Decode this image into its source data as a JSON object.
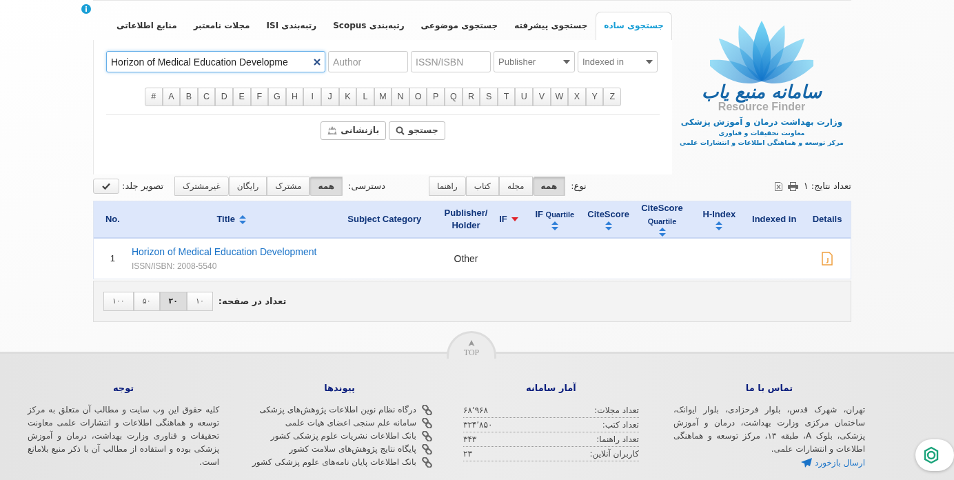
{
  "logo": {
    "title": "سامانه منبع یاب",
    "subtitle": "Resource Finder",
    "org_lines": [
      "وزارت بهداشت درمان و آموزش پزشکی",
      "معاونت تحقیقات و فناوری",
      "مرکز توسعه و هماهنگی اطلاعات و انتشارات علمی"
    ]
  },
  "tabs": [
    {
      "label": "جستجوی ساده",
      "selected": true
    },
    {
      "label": "جستجوی پیشرفته",
      "selected": false
    },
    {
      "label": "جستجوی موضوعی",
      "selected": false
    },
    {
      "label": "رتبه‌بندی Scopus",
      "selected": false
    },
    {
      "label": "رتبه‌بندی ISI",
      "selected": false
    },
    {
      "label": "مجلات نامعتبر",
      "selected": false
    },
    {
      "label": "منابع اطلاعاتی",
      "selected": false
    }
  ],
  "search": {
    "fields": [
      {
        "kind": "select",
        "placeholder": "Indexed in",
        "focused": false
      },
      {
        "kind": "select",
        "placeholder": "Publisher",
        "focused": false
      },
      {
        "kind": "text",
        "placeholder": "ISSN/ISBN",
        "focused": false
      },
      {
        "kind": "text",
        "placeholder": "Author",
        "focused": false
      },
      {
        "kind": "text",
        "value": "Horizon of Medical Education Developme",
        "focused": true
      }
    ],
    "letters": [
      "Z",
      "Y",
      "X",
      "W",
      "V",
      "U",
      "T",
      "S",
      "R",
      "Q",
      "P",
      "O",
      "N",
      "M",
      "L",
      "K",
      "J",
      "I",
      "H",
      "G",
      "F",
      "E",
      "D",
      "C",
      "B",
      "A",
      "#"
    ],
    "search_button": "جستجو",
    "reset_button": "بازنشانی"
  },
  "filters": {
    "result_count": "تعداد نتایج: ۱",
    "type": {
      "label": "نوع:",
      "options": [
        {
          "label": "همه",
          "selected": true
        },
        {
          "label": "مجله",
          "selected": false
        },
        {
          "label": "کتاب",
          "selected": false
        },
        {
          "label": "راهنما",
          "selected": false
        }
      ]
    },
    "access": {
      "label": "دسترسی:",
      "options": [
        {
          "label": "همه",
          "selected": true
        },
        {
          "label": "مشترک",
          "selected": false
        },
        {
          "label": "رایگان",
          "selected": false
        },
        {
          "label": "غیرمشترک",
          "selected": false
        }
      ]
    },
    "cover": {
      "label": "تصویر جلد:"
    }
  },
  "table": {
    "columns": [
      {
        "label": "Details",
        "sortable": false
      },
      {
        "label": "Indexed in",
        "sortable": false
      },
      {
        "label": "H-Index",
        "sortable": true,
        "sorted_descending": false
      },
      {
        "label": "CiteScore",
        "sublabel": "Quartile",
        "sortable": true,
        "sorted_descending": false
      },
      {
        "label": "CiteScore",
        "sortable": true,
        "sorted_descending": false
      },
      {
        "label": "IF",
        "sublabel": "Quartile",
        "sortable": true,
        "sorted_descending": false
      },
      {
        "label": "IF",
        "sortable": true,
        "sorted_descending": true
      },
      {
        "label": "Publisher/ Holder",
        "sortable": false
      },
      {
        "label": "Subject Category",
        "sortable": false
      },
      {
        "label": "Title",
        "sortable": true,
        "sorted_descending": false
      },
      {
        "label": "No.",
        "sortable": false
      }
    ],
    "rows": [
      {
        "no": "1",
        "title": "Horizon of Medical Education Development",
        "issn": "ISSN/ISBN: 2008-5540",
        "publisher": "Other"
      }
    ]
  },
  "pagination": {
    "label": "تعداد در صفحه:",
    "options": [
      {
        "label": "۱۰",
        "selected": false
      },
      {
        "label": "۲۰",
        "selected": true
      },
      {
        "label": "۵۰",
        "selected": false
      },
      {
        "label": "۱۰۰",
        "selected": false
      }
    ]
  },
  "top_label": "TOP",
  "footer": {
    "contact": {
      "title": "تماس با ما",
      "text": "تهران، شهرک قدس، بلوار فرحزادی، بلوار ایوانک، ساختمان مرکزی وزارت بهداشت، درمان و آموزش پزشکی، بلوک A، طبقه ۱۳، مرکز توسعه و هماهنگی اطلاعات و انتشارات علمی.",
      "feedback": "ارسال بازخورد"
    },
    "stats": {
      "title": "آمار سامانه",
      "rows": [
        {
          "label": "تعداد مجلات:",
          "value": "۶۸٬۹۶۸"
        },
        {
          "label": "تعداد کتب:",
          "value": "۳۲۴٬۸۵۰"
        },
        {
          "label": "تعداد راهنما:",
          "value": "۳۴۳"
        },
        {
          "label": "کاربران آنلاین:",
          "value": "۲۳"
        }
      ]
    },
    "links": {
      "title": "پیوندها",
      "items": [
        "درگاه نظام نوین اطلاعات پژوهش‌های پزشکی",
        "سامانه علم سنجی اعضای هیات علمی",
        "بانک اطلاعات نشریات علوم پزشکی کشور",
        "پایگاه نتایج پژوهش‌های سلامت کشور",
        "بانک اطلاعات پایان نامه‌های علوم پزشکی کشور"
      ]
    },
    "notice": {
      "title": "توجه",
      "text": "کلیه حقوق این وب سایت و مطالب آن متعلق به مرکز توسعه و هماهنگی اطلاعات و انتشارات علمی معاونت تحقیقات و فناوری وزارت بهداشت، درمان و آموزش پزشکی بوده و استفاده از مطالب آن با ذکر منبع بلامانع است."
    }
  }
}
